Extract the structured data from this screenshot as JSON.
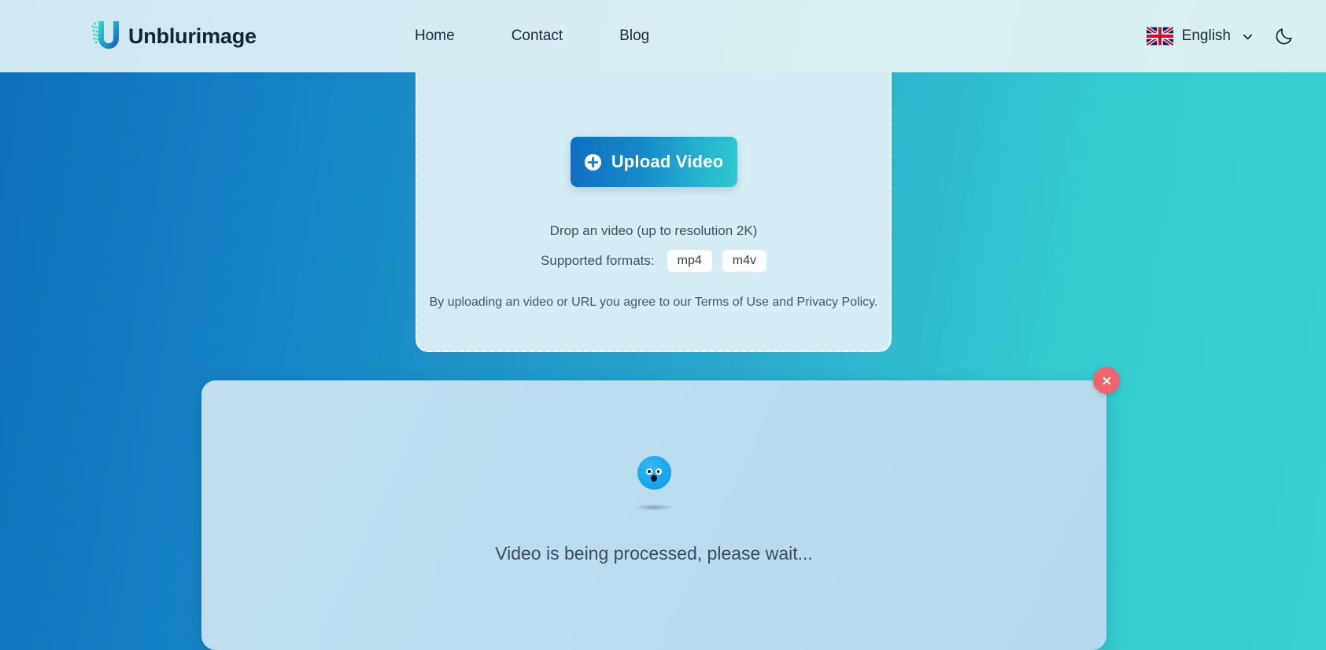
{
  "header": {
    "brand": {
      "name": "Unblurimage",
      "logo_icon": "u-logo-icon"
    },
    "nav": [
      {
        "label": "Home",
        "name": "nav-link-home"
      },
      {
        "label": "Contact",
        "name": "nav-link-contact"
      },
      {
        "label": "Blog",
        "name": "nav-link-blog"
      }
    ],
    "language": {
      "label": "English",
      "flag_icon": "uk-flag-icon",
      "chevron_icon": "chevron-down-icon"
    },
    "theme_toggle": {
      "icon": "moon-icon"
    },
    "colors": {
      "background_start": "#cfe7f2",
      "background_end": "#d8f1f0",
      "text": "#1b2b3c"
    }
  },
  "page": {
    "background_gradient_start": "#0f6fb8",
    "background_gradient_end": "#3ad2ce"
  },
  "upload_card": {
    "upload_button": {
      "label": "Upload Video",
      "icon": "plus-circle-icon",
      "gradient_start": "#0f6fc0",
      "gradient_end": "#2fc9d2"
    },
    "drop_hint": "Drop an video (up to resolution 2K)",
    "formats_label": "Supported formats:",
    "formats": [
      "mp4",
      "m4v"
    ],
    "terms": {
      "prefix": "By uploading an video or URL you agree to our ",
      "terms_link": "Terms of Use",
      "conjunction": " and ",
      "privacy_link": "Privacy Policy",
      "suffix": "."
    },
    "border_style": "dashed",
    "background_color": "#e2f2f8"
  },
  "processing_card": {
    "status_text": "Video is being processed, please wait...",
    "loader_icon": "bouncing-ball-loader-icon",
    "close_button": {
      "icon": "close-x-icon",
      "color": "#f2646c"
    },
    "background_color": "#bcdcef"
  }
}
